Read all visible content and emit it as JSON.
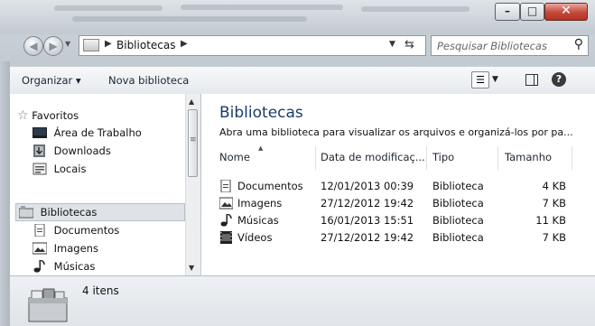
{
  "window": {
    "minimize_glyph": "–",
    "maximize_glyph": "□",
    "close_glyph": "✕"
  },
  "address": {
    "path": "Bibliotecas",
    "search_placeholder": "Pesquisar Bibliotecas"
  },
  "toolbar": {
    "organize_label": "Organizar ▾",
    "new_library_label": "Nova biblioteca",
    "help_label": "?"
  },
  "nav": {
    "favorites_label": "Favoritos",
    "items": [
      {
        "label": "Área de Trabalho",
        "icon": "desktop-icon"
      },
      {
        "label": "Downloads",
        "icon": "downloads-icon"
      },
      {
        "label": "Locais",
        "icon": "recent-places-icon"
      }
    ],
    "libraries_label": "Bibliotecas",
    "library_items": [
      {
        "label": "Documentos",
        "icon": "documents-icon"
      },
      {
        "label": "Imagens",
        "icon": "pictures-icon"
      },
      {
        "label": "Músicas",
        "icon": "music-icon"
      }
    ]
  },
  "content": {
    "title": "Bibliotecas",
    "subtitle": "Abra uma biblioteca para visualizar os arquivos e organizá-los por pa...",
    "columns": [
      "Nome",
      "Data de modificaç...",
      "Tipo",
      "Tamanho"
    ],
    "rows": [
      {
        "name": "Documentos",
        "date": "12/01/2013 00:39",
        "type": "Biblioteca",
        "size": "4 KB",
        "icon": "documents-icon"
      },
      {
        "name": "Imagens",
        "date": "27/12/2012 19:42",
        "type": "Biblioteca",
        "size": "7 KB",
        "icon": "pictures-icon"
      },
      {
        "name": "Músicas",
        "date": "16/01/2013 15:51",
        "type": "Biblioteca",
        "size": "11 KB",
        "icon": "music-icon"
      },
      {
        "name": "Vídeos",
        "date": "27/12/2012 19:42",
        "type": "Biblioteca",
        "size": "7 KB",
        "icon": "videos-icon"
      }
    ]
  },
  "details": {
    "count_text": "4 itens"
  },
  "colors": {
    "close_button": "#c2493a",
    "title_text": "#1a3b6a",
    "selection": "#dfe3e8"
  }
}
